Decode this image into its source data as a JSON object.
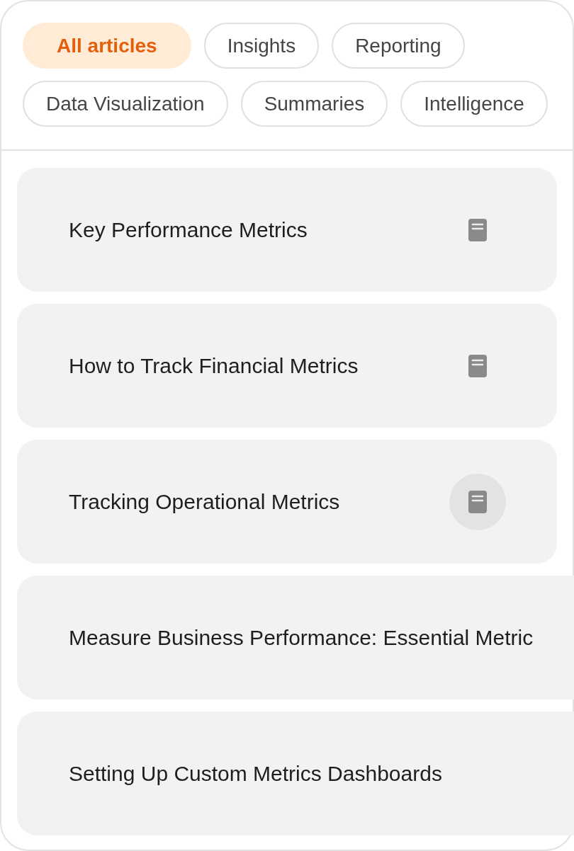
{
  "filters": [
    {
      "label": "All articles",
      "selected": true
    },
    {
      "label": "Insights",
      "selected": false
    },
    {
      "label": "Reporting",
      "selected": false
    },
    {
      "label": "Data Visualization",
      "selected": false
    },
    {
      "label": "Summaries",
      "selected": false
    },
    {
      "label": "Intelligence",
      "selected": false
    }
  ],
  "articles": [
    {
      "title": "Key Performance Metrics",
      "has_icon": true,
      "icon_highlighted": false
    },
    {
      "title": "How to Track Financial Metrics",
      "has_icon": true,
      "icon_highlighted": false
    },
    {
      "title": "Tracking Operational Metrics",
      "has_icon": true,
      "icon_highlighted": true
    },
    {
      "title": "Measure Business Performance: Essential Metric",
      "has_icon": false
    },
    {
      "title": "Setting Up Custom Metrics Dashboards",
      "has_icon": false
    }
  ]
}
